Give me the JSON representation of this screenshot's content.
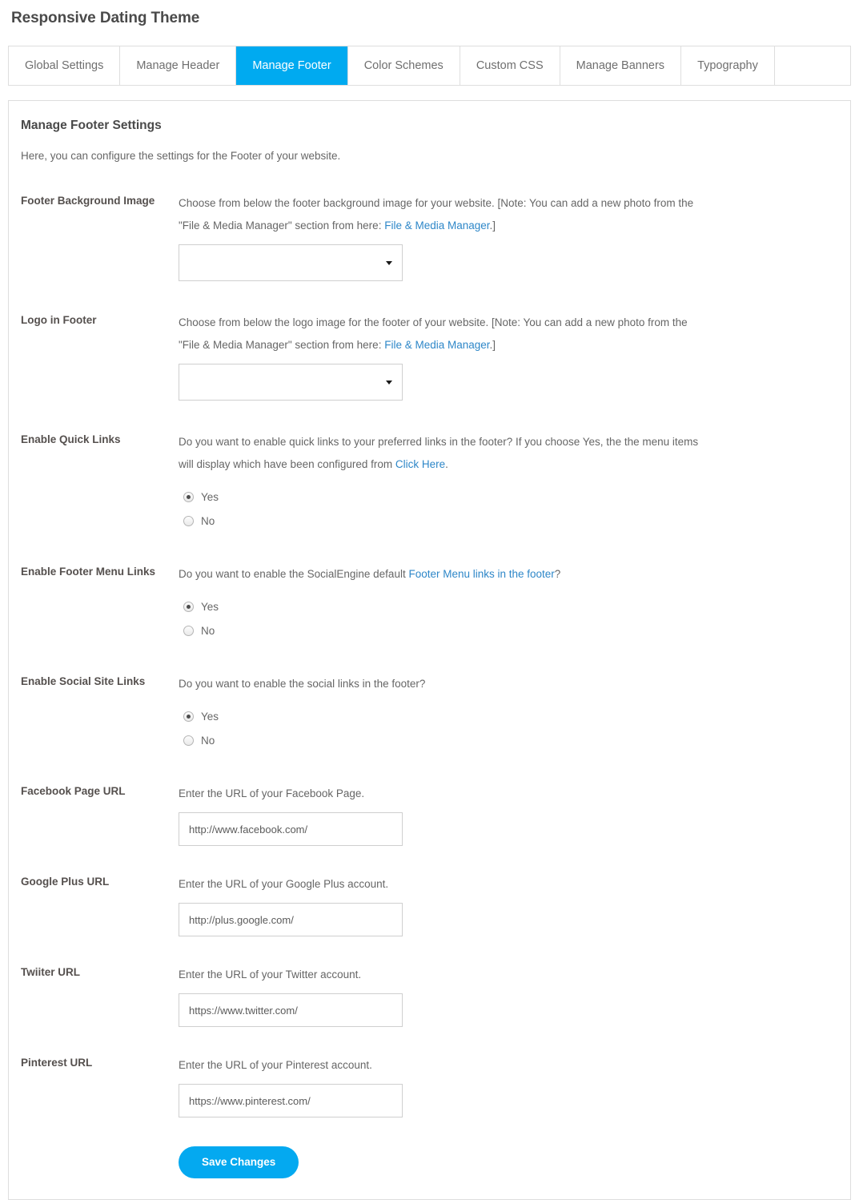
{
  "page": {
    "title": "Responsive Dating Theme"
  },
  "tabs": [
    {
      "label": "Global Settings",
      "active": false
    },
    {
      "label": "Manage Header",
      "active": false
    },
    {
      "label": "Manage Footer",
      "active": true
    },
    {
      "label": "Color Schemes",
      "active": false
    },
    {
      "label": "Custom CSS",
      "active": false
    },
    {
      "label": "Manage Banners",
      "active": false
    },
    {
      "label": "Typography",
      "active": false
    }
  ],
  "panel": {
    "title": "Manage Footer Settings",
    "description": "Here, you can configure the settings for the Footer of your website."
  },
  "fields": {
    "footer_background_image": {
      "label": "Footer Background Image",
      "desc_part1": "Choose from below the footer background image for your website. [Note: You can add a new photo from the \"File & Media Manager\" section from here: ",
      "link_text": "File & Media Manager",
      "desc_part2": ".]",
      "select_value": ""
    },
    "logo_in_footer": {
      "label": "Logo in Footer",
      "desc_part1": "Choose from below the logo image for the footer of your website. [Note: You can add a new photo from the \"File & Media Manager\" section from here: ",
      "link_text": "File & Media Manager",
      "desc_part2": ".]",
      "select_value": ""
    },
    "enable_quick_links": {
      "label": "Enable Quick Links",
      "desc_part1": "Do you want to enable quick links to your preferred links in the footer? If you choose Yes, the the menu items will display which have been configured from ",
      "link_text": "Click Here",
      "desc_part2": ".",
      "option_yes": "Yes",
      "option_no": "No",
      "selected": "Yes"
    },
    "enable_footer_menu_links": {
      "label": "Enable Footer Menu Links",
      "desc_part1": "Do you want to enable the SocialEngine default ",
      "link_text": "Footer Menu links in the footer",
      "desc_part2": "?",
      "option_yes": "Yes",
      "option_no": "No",
      "selected": "Yes"
    },
    "enable_social_site_links": {
      "label": "Enable Social Site Links",
      "description": "Do you want to enable the social links in the footer?",
      "option_yes": "Yes",
      "option_no": "No",
      "selected": "Yes"
    },
    "facebook_page_url": {
      "label": "Facebook Page URL",
      "description": "Enter the URL of your Facebook Page.",
      "value": "http://www.facebook.com/"
    },
    "google_plus_url": {
      "label": "Google Plus URL",
      "description": "Enter the URL of your Google Plus account.",
      "value": "http://plus.google.com/"
    },
    "twitter_url": {
      "label": "Twiiter URL",
      "description": "Enter the URL of your Twitter account.",
      "value": "https://www.twitter.com/"
    },
    "pinterest_url": {
      "label": "Pinterest URL",
      "description": "Enter the URL of your Pinterest account.",
      "value": "https://www.pinterest.com/"
    }
  },
  "actions": {
    "save_label": "Save Changes"
  },
  "colors": {
    "accent": "#00AAF0",
    "link": "#2e87c8",
    "button": "#04A9F0",
    "border": "#dedede"
  }
}
